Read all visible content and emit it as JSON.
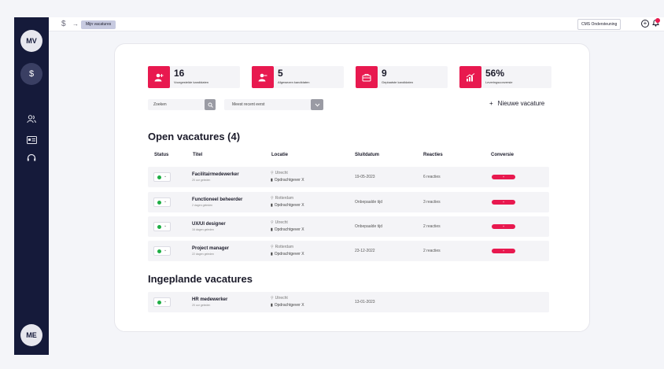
{
  "sidebar": {
    "user_initials": "MV",
    "bottom_initials": "ME",
    "icons": [
      "dollar-icon",
      "users-icon",
      "id-card-icon",
      "headset-icon"
    ]
  },
  "topbar": {
    "breadcrumb": "Mijn vacatures",
    "cms_button": "CMS Ondersteuning"
  },
  "stats": [
    {
      "value": "16",
      "label": "Voorgestelde kandidaten",
      "icon": "user-plus-icon"
    },
    {
      "value": "5",
      "label": "Afgewezen kandidaten",
      "icon": "user-minus-icon"
    },
    {
      "value": "9",
      "label": "Geplaatste kandidaten",
      "icon": "briefcase-icon"
    },
    {
      "value": "56%",
      "label": "Leveringsconversie",
      "icon": "chart-icon"
    }
  ],
  "filters": {
    "search_placeholder": "Zoeken",
    "sort_value": "Meest recent eerst",
    "new_button": "Nieuwe vacature"
  },
  "open_section": {
    "title": "Open vacatures (4)",
    "columns": [
      "Status",
      "Titel",
      "Locatie",
      "Sluitdatum",
      "Reacties",
      "Conversie"
    ],
    "rows": [
      {
        "title": "Facilitairmedewerker",
        "sub": "20 uur geleden",
        "location": "Utrecht",
        "client": "Opdrachtgever X",
        "date": "19-05-2023",
        "reactions": "6 reacties",
        "conversion": 0.6
      },
      {
        "title": "Functioneel beheerder",
        "sub": "2 dagen geleden",
        "location": "Rotterdam",
        "client": "Opdrachtgever X",
        "date": "Onbepaalde tijd",
        "reactions": "3 reacties",
        "conversion": 0.6
      },
      {
        "title": "UX/UI designer",
        "sub": "16 dagen geleden",
        "location": "Utrecht",
        "client": "Opdrachtgever X",
        "date": "Onbepaalde tijd",
        "reactions": "2 reacties",
        "conversion": 0.6
      },
      {
        "title": "Project manager",
        "sub": "22 dagen geleden",
        "location": "Rotterdam",
        "client": "Opdrachtgever X",
        "date": "23-12-2022",
        "reactions": "2 reacties",
        "conversion": 0.6
      }
    ]
  },
  "planned_section": {
    "title": "Ingeplande vacatures",
    "rows": [
      {
        "title": "HR medewerker",
        "sub": "20 uur geleden",
        "location": "Utrecht",
        "client": "Opdrachtgever X",
        "date": "13-01-2023"
      }
    ]
  },
  "colors": {
    "accent": "#e8194f",
    "sidebar": "#151a3a",
    "status_green": "#1fae45"
  }
}
